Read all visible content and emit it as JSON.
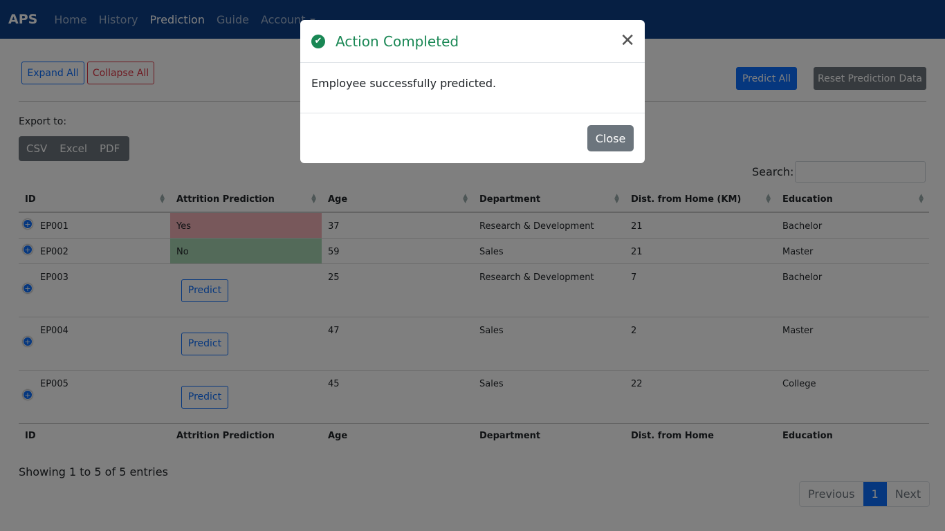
{
  "nav": {
    "brand": "APS",
    "items": [
      {
        "label": "Home"
      },
      {
        "label": "History"
      },
      {
        "label": "Prediction"
      },
      {
        "label": "Guide"
      },
      {
        "label": "Account"
      }
    ]
  },
  "toolbar": {
    "expand_all": "Expand All",
    "collapse_all": "Collapse All",
    "predict_all": "Predict All",
    "reset": "Reset Prediction Data"
  },
  "export": {
    "label": "Export to:",
    "options": [
      "CSV",
      "Excel",
      "PDF"
    ]
  },
  "search": {
    "label": "Search:",
    "value": ""
  },
  "table": {
    "headers": [
      "ID",
      "Attrition Prediction",
      "Age",
      "Department",
      "Dist. from Home (KM)",
      "Education"
    ],
    "footer_headers": [
      "ID",
      "Attrition Prediction",
      "Age",
      "Department",
      "Dist. from Home",
      "Education"
    ],
    "predict_label": "Predict",
    "expand_glyph": "+",
    "rows": [
      {
        "id": "EP001",
        "prediction": "Yes",
        "age": "37",
        "department": "Research & Development",
        "distance": "21",
        "education": "Bachelor"
      },
      {
        "id": "EP002",
        "prediction": "No",
        "age": "59",
        "department": "Sales",
        "distance": "21",
        "education": "Master"
      },
      {
        "id": "EP003",
        "prediction": "",
        "age": "25",
        "department": "Research & Development",
        "distance": "7",
        "education": "Bachelor"
      },
      {
        "id": "EP004",
        "prediction": "",
        "age": "47",
        "department": "Sales",
        "distance": "2",
        "education": "Master"
      },
      {
        "id": "EP005",
        "prediction": "",
        "age": "45",
        "department": "Sales",
        "distance": "22",
        "education": "College"
      }
    ]
  },
  "footer": {
    "showing": "Showing 1 to 5 of 5 entries"
  },
  "pagination": {
    "previous": "Previous",
    "current": "1",
    "next": "Next"
  },
  "modal": {
    "title": "Action Completed",
    "body": "Employee successfully predicted.",
    "close_label": "Close",
    "close_glyph": "✕",
    "check_glyph": "✔"
  },
  "colors": {
    "navbar": "#0d3f86",
    "yes": "#f1b0b7",
    "no": "#a6d5b2",
    "success": "#198754",
    "primary": "#0d6efd"
  }
}
